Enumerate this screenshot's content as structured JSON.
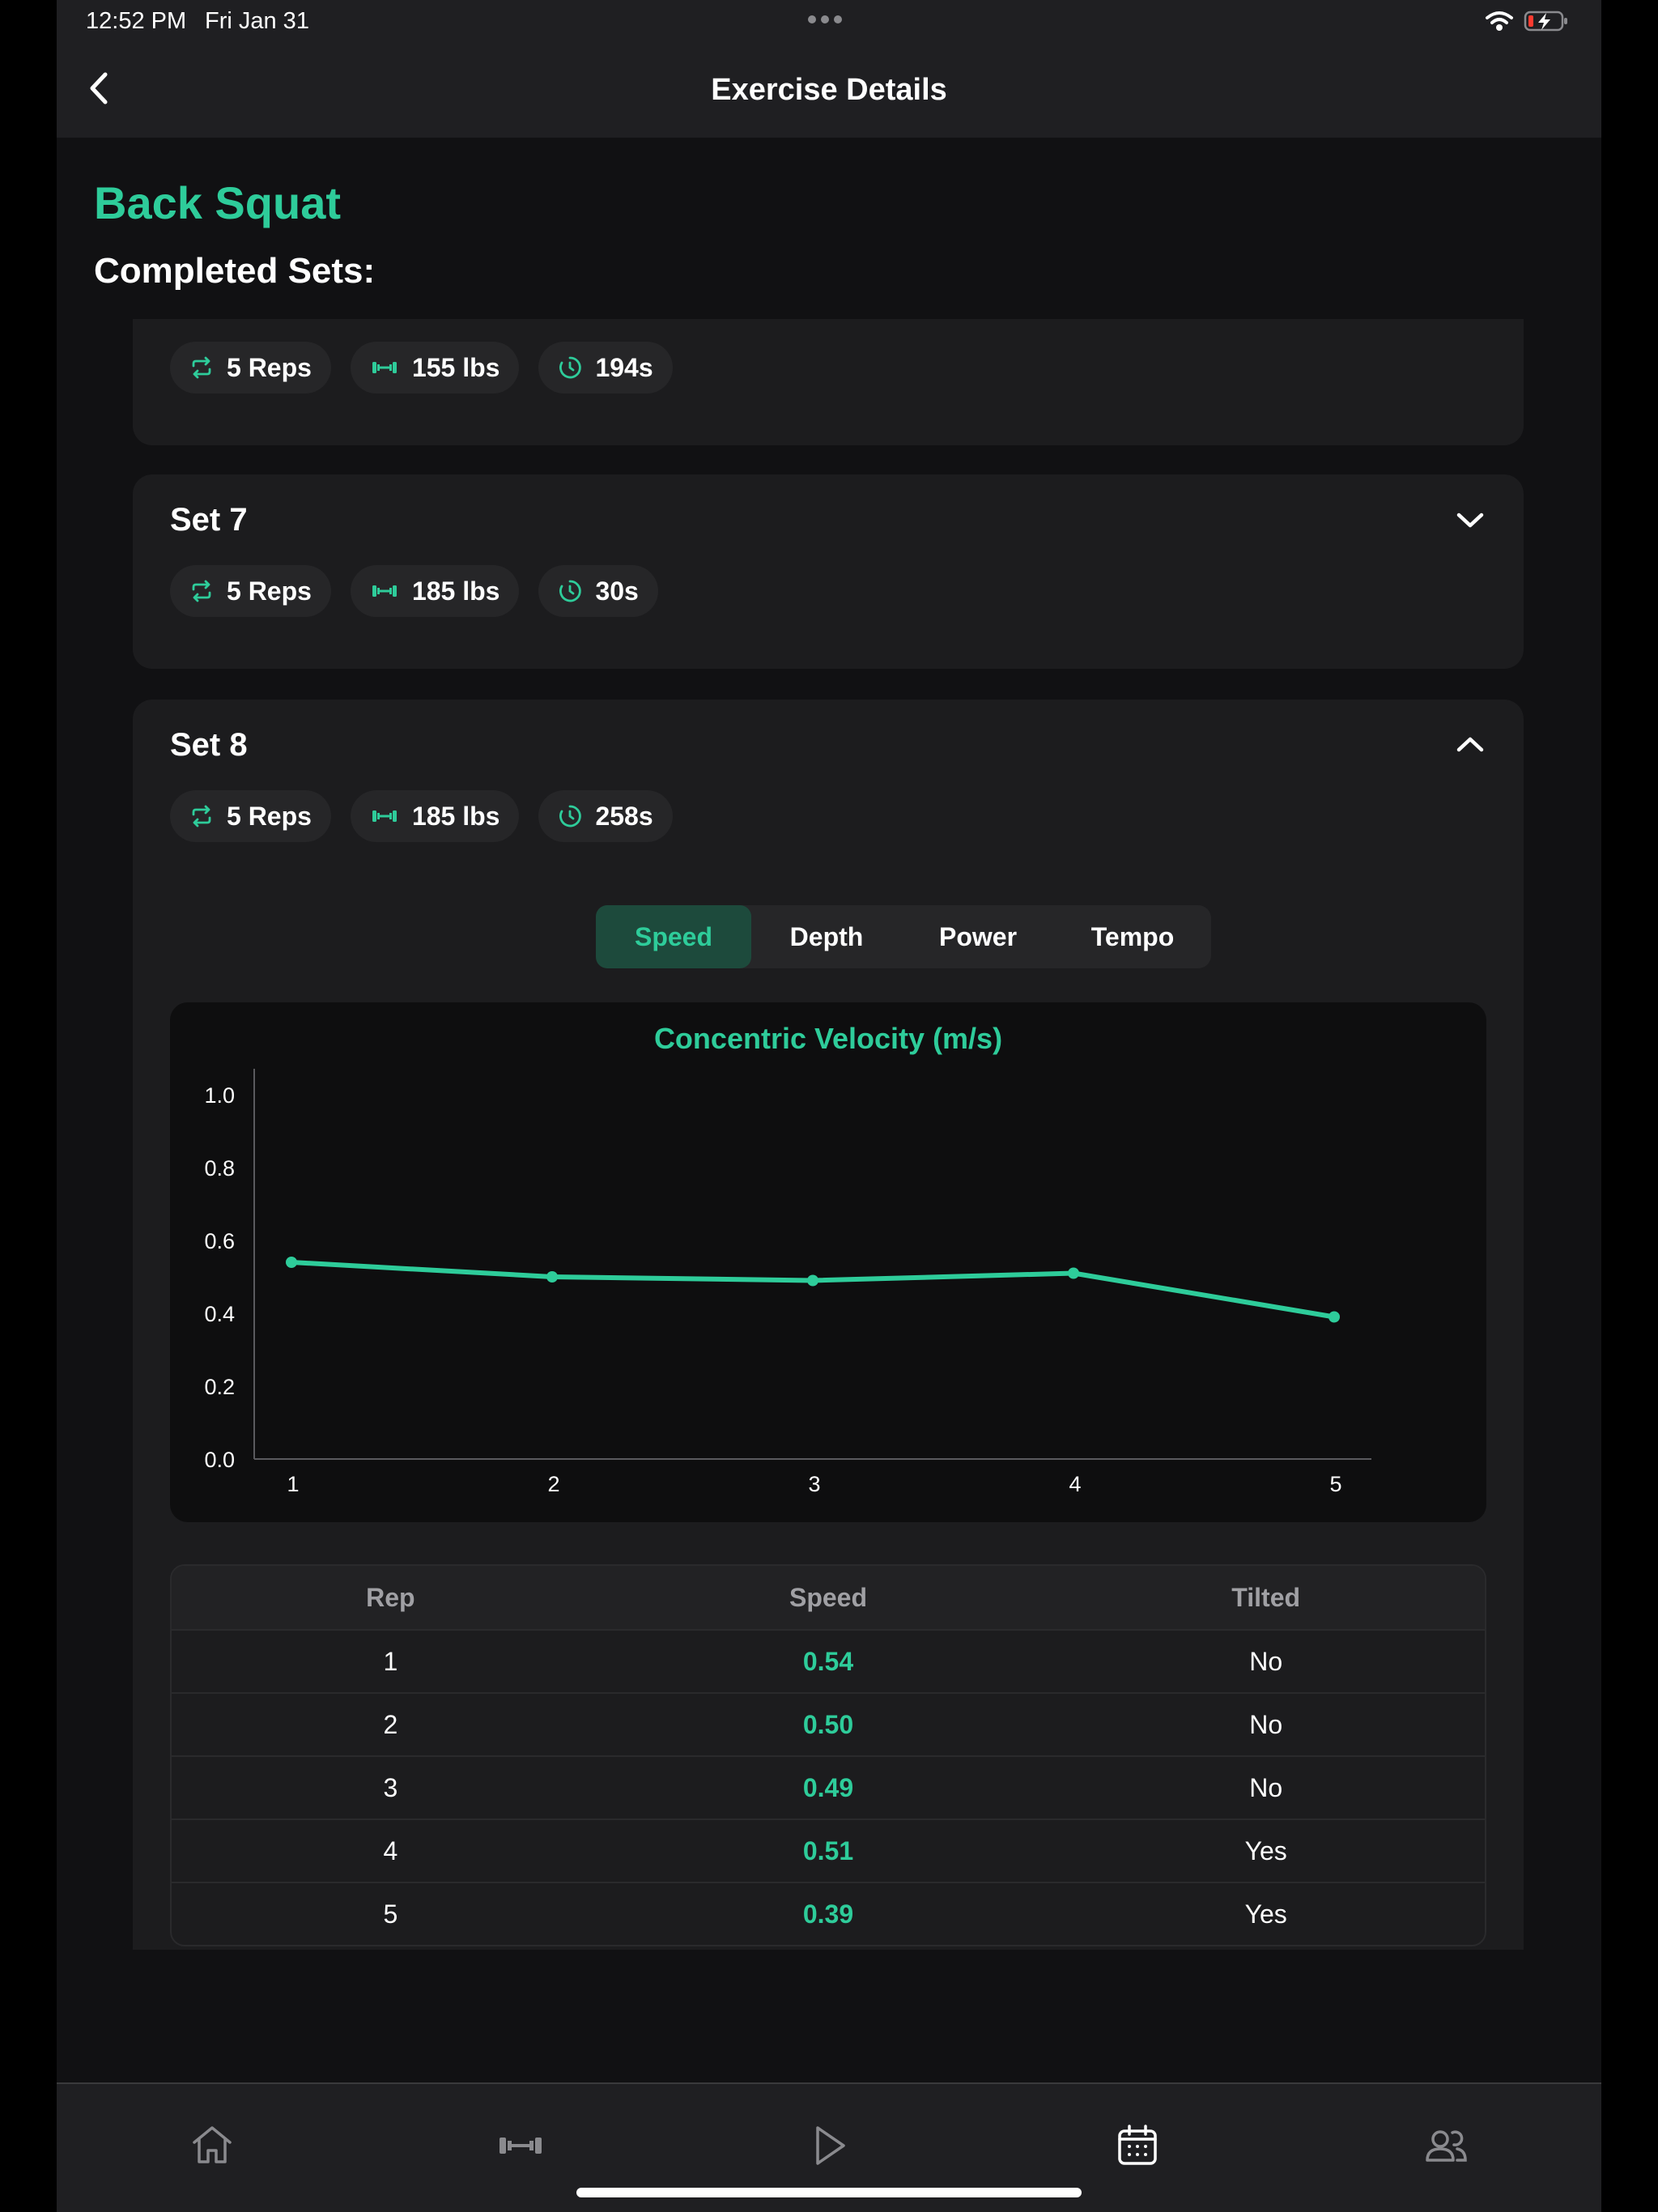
{
  "status": {
    "time": "12:52 PM",
    "date": "Fri Jan 31"
  },
  "nav": {
    "title": "Exercise Details"
  },
  "exercise": {
    "name": "Back Squat",
    "completed_label": "Completed Sets:"
  },
  "sets": [
    {
      "title": "",
      "reps": "5 Reps",
      "weight": "155 lbs",
      "rest": "194s",
      "expanded": false
    },
    {
      "title": "Set 7",
      "reps": "5 Reps",
      "weight": "185 lbs",
      "rest": "30s",
      "expanded": false
    },
    {
      "title": "Set 8",
      "reps": "5 Reps",
      "weight": "185 lbs",
      "rest": "258s",
      "expanded": true
    }
  ],
  "tabs": [
    "Speed",
    "Depth",
    "Power",
    "Tempo"
  ],
  "active_tab": "Speed",
  "chart_data": {
    "type": "line",
    "title": "Concentric Velocity (m/s)",
    "x": [
      1,
      2,
      3,
      4,
      5
    ],
    "values": [
      0.54,
      0.5,
      0.49,
      0.51,
      0.39
    ],
    "ylim": [
      0,
      1.0
    ],
    "yticks": [
      "0.0",
      "0.2",
      "0.4",
      "0.6",
      "0.8",
      "1.0"
    ],
    "xticks": [
      "1",
      "2",
      "3",
      "4",
      "5"
    ],
    "color": "#2ecc9a"
  },
  "table": {
    "headers": [
      "Rep",
      "Speed",
      "Tilted"
    ],
    "rows": [
      [
        "1",
        "0.54",
        "No"
      ],
      [
        "2",
        "0.50",
        "No"
      ],
      [
        "3",
        "0.49",
        "No"
      ],
      [
        "4",
        "0.51",
        "Yes"
      ],
      [
        "5",
        "0.39",
        "Yes"
      ]
    ]
  },
  "tabbar": [
    "home-icon",
    "dumbbell-icon",
    "play-icon",
    "calendar-icon",
    "people-icon"
  ],
  "colors": {
    "accent": "#2ecc9a",
    "background": "#111113",
    "card": "#1c1c1e"
  }
}
